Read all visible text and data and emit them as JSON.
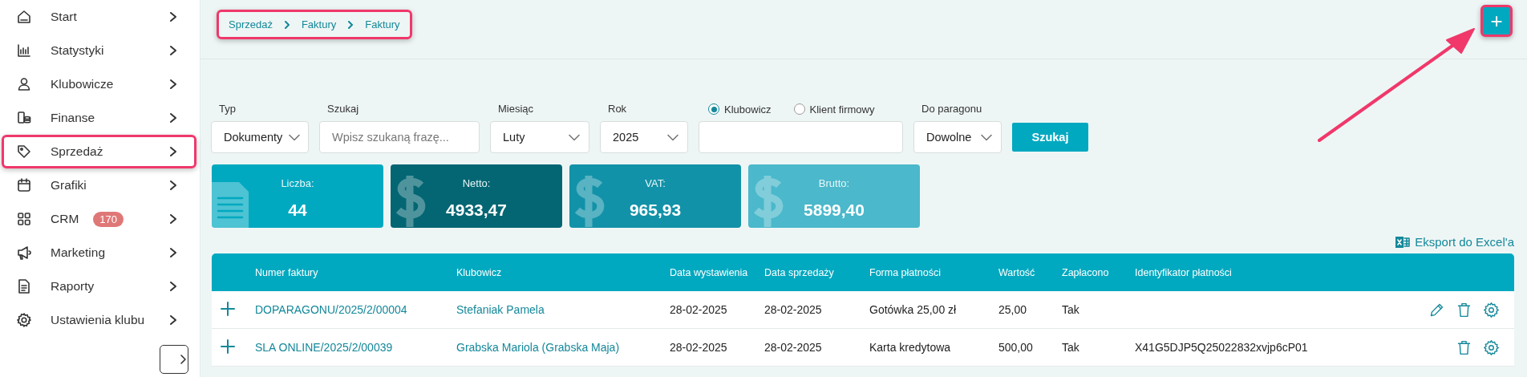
{
  "sidebar": {
    "items": [
      {
        "label": "Start",
        "selected": false,
        "highlighted": false
      },
      {
        "label": "Statystyki",
        "selected": false,
        "highlighted": false
      },
      {
        "label": "Klubowicze",
        "selected": false,
        "highlighted": false
      },
      {
        "label": "Finanse",
        "selected": false,
        "highlighted": false
      },
      {
        "label": "Sprzedaż",
        "selected": false,
        "highlighted": true
      },
      {
        "label": "Grafiki",
        "selected": false,
        "highlighted": false
      },
      {
        "label": "CRM",
        "selected": false,
        "highlighted": false,
        "badge": "170"
      },
      {
        "label": "Marketing",
        "selected": false,
        "highlighted": false
      },
      {
        "label": "Raporty",
        "selected": false,
        "highlighted": false
      },
      {
        "label": "Ustawienia klubu",
        "selected": false,
        "highlighted": false
      }
    ]
  },
  "breadcrumb": {
    "highlighted": true,
    "items": [
      "Sprzedaż",
      "Faktury",
      "Faktury"
    ]
  },
  "add_button": {
    "label": "+",
    "highlighted": true
  },
  "annotation_arrow": true,
  "filters": [
    {
      "kind": "select",
      "label": "Typ",
      "value": "Dokumenty"
    },
    {
      "kind": "text",
      "label": "Szukaj",
      "placeholder": "Wpisz szukaną frazę..."
    },
    {
      "kind": "select",
      "label": "Miesiąc",
      "value": "Luty"
    },
    {
      "kind": "select",
      "label": "Rok",
      "value": "2025"
    },
    {
      "kind": "radio_text",
      "options": [
        {
          "label": "Klubowicz",
          "selected": true
        },
        {
          "label": "Klient firmowy",
          "selected": false
        }
      ]
    },
    {
      "kind": "select",
      "label": "Do paragonu",
      "value": "Dowolne"
    }
  ],
  "search_button": "Szukaj",
  "stats": [
    {
      "kind": "count",
      "label": "Liczba:",
      "value": "44",
      "color": "#00a9c0"
    },
    {
      "kind": "money",
      "label": "Netto:",
      "value": "4933,47",
      "color": "#046673"
    },
    {
      "kind": "money",
      "label": "VAT:",
      "value": "965,93",
      "color": "#1292a8"
    },
    {
      "kind": "money",
      "label": "Brutto:",
      "value": "5899,40",
      "color": "#4bb8cb"
    }
  ],
  "export_link": "Eksport do Excel'a",
  "table": {
    "columns": [
      "Numer faktury",
      "Klubowicz",
      "Data wystawienia",
      "Data sprzedaży",
      "Forma płatności",
      "Wartość",
      "Zapłacono",
      "Identyfikator płatności"
    ],
    "rows": [
      {
        "cells": [
          "DOPARAGONU/2025/2/00004",
          "Stefaniak Pamela",
          "28-02-2025",
          "28-02-2025",
          "Gotówka 25,00 zł",
          "25,00",
          "Tak",
          ""
        ],
        "actions": [
          {
            "kind": "edit"
          },
          {
            "kind": "delete"
          },
          {
            "kind": "settings"
          }
        ]
      },
      {
        "cells": [
          "SLA ONLINE/2025/2/00039",
          "Grabska Mariola (Grabska Maja)",
          "28-02-2025",
          "28-02-2025",
          "Karta kredytowa",
          "500,00",
          "Tak",
          "X41G5DJP5Q25022832xvjp6cP01"
        ],
        "actions": [
          {
            "kind": "delete"
          },
          {
            "kind": "settings"
          }
        ]
      }
    ]
  }
}
